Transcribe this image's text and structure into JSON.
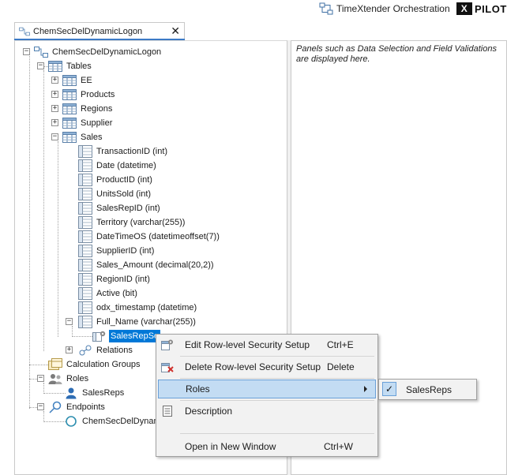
{
  "header": {
    "orchestration_label": "TimeXtender Orchestration",
    "pilot_x": "X",
    "pilot_label": "PILOT"
  },
  "tab": {
    "title": "ChemSecDelDynamicLogon",
    "close_glyph": "✕"
  },
  "right_panel": {
    "info": "Panels such as Data Selection and Field Validations are displayed here."
  },
  "tree": {
    "root": "ChemSecDelDynamicLogon",
    "tables_label": "Tables",
    "tables": [
      "EE",
      "Products",
      "Regions",
      "Supplier",
      "Sales"
    ],
    "sales_fields": [
      "TransactionID (int)",
      "Date (datetime)",
      "ProductID (int)",
      "UnitsSold (int)",
      "SalesRepID (int)",
      "Territory (varchar(255))",
      "DateTimeOS (datetimeoffset(7))",
      "SupplierID (int)",
      "Sales_Amount (decimal(20,2))",
      "RegionID (int)",
      "Active (bit)",
      "odx_timestamp (datetime)",
      "Full_Name (varchar(255))"
    ],
    "selected_item": "SalesRepSe",
    "relations": "Relations",
    "calc_groups": "Calculation Groups",
    "roles": "Roles",
    "role_item": "SalesReps",
    "endpoints": "Endpoints",
    "endpoint_item": "ChemSecDelDynam"
  },
  "context_menu": {
    "edit": {
      "label": "Edit Row-level Security Setup",
      "shortcut": "Ctrl+E"
    },
    "delete": {
      "label": "Delete Row-level Security Setup",
      "shortcut": "Delete"
    },
    "roles": {
      "label": "Roles"
    },
    "description": {
      "label": "Description"
    },
    "open_new": {
      "label": "Open in New Window",
      "shortcut": "Ctrl+W"
    }
  },
  "roles_submenu": {
    "item": "SalesReps",
    "check": "✓"
  },
  "colors": {
    "selection": "#0078d7",
    "menu_highlight": "#c3dcf3",
    "menu_bg": "#f2f2f2"
  },
  "icons": [
    "orchestration-icon",
    "model-icon",
    "table-icon",
    "field-icon",
    "security-icon",
    "relations-icon",
    "calc-group-icon",
    "roles-icon",
    "user-icon",
    "endpoints-icon",
    "endpoint-icon",
    "delete-security-icon",
    "description-icon",
    "check-icon",
    "submenu-arrow-icon"
  ]
}
